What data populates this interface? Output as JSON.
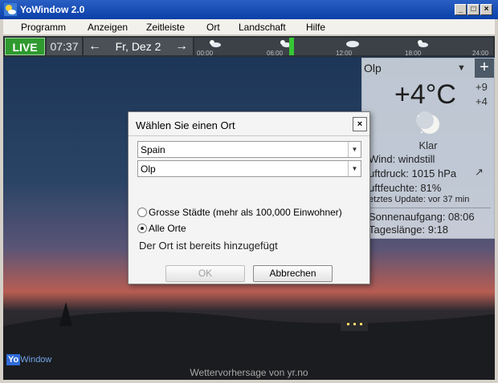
{
  "window": {
    "title": "YoWindow 2.0",
    "min": "_",
    "max": "□",
    "close": "×"
  },
  "menu": [
    "Programm",
    "Anzeigen",
    "Zeitleiste",
    "Ort",
    "Landschaft",
    "Hilfe"
  ],
  "timeline": {
    "live": "LIVE",
    "time": "07:37",
    "prev": "←",
    "next": "→",
    "date": "Fr, Dez 2",
    "ticks": [
      "00:00",
      "06:00",
      "12:00",
      "18:00",
      "24:00"
    ]
  },
  "weather": {
    "location": "Olp",
    "dropdown": "▼",
    "add": "+",
    "temp": "+4°C",
    "temp_high": "+9",
    "temp_low": "+4",
    "condition": "Klar",
    "wind": "Wind:  windstill",
    "pressure": "uftdruck:  1015 hPa",
    "humidity": "uftfeuchte:  81%",
    "updated": "etztes Update:  vor 37 min",
    "sunrise": "Sonnenaufgang:  08:06",
    "daylength": "Tageslänge:  9:18",
    "pressure_icon": "↗"
  },
  "dialog": {
    "title": "Wählen Sie einen Ort",
    "close": "×",
    "country": "Spain",
    "place": "Olp",
    "radio_big": "Grosse Städte (mehr als 100,000 Einwohner)",
    "radio_all": "Alle Orte",
    "message": "Der Ort ist bereits hinzugefügt",
    "ok": "OK",
    "cancel": "Abbrechen"
  },
  "brand": {
    "yo": "Yo",
    "win": "Window"
  },
  "footer": "Wettervorhersage von yr.no"
}
